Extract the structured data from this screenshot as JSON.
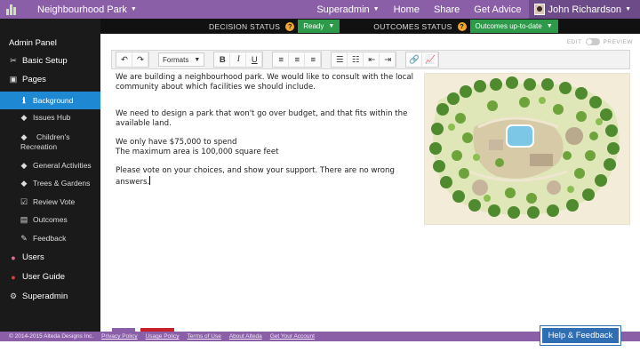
{
  "header": {
    "site_name": "Neighbourhood Park",
    "links": [
      "Superadmin",
      "Home",
      "Share",
      "Get Advice"
    ],
    "user_name": "John Richardson"
  },
  "status": {
    "decision_label": "DECISION STATUS",
    "decision_value": "Ready",
    "outcomes_label": "OUTCOMES STATUS",
    "outcomes_value": "Outcomes up-to-date",
    "question_mark": "?"
  },
  "sidebar": {
    "title": "Admin Panel",
    "items": [
      {
        "label": "Basic Setup",
        "icon": "wrench-icon"
      },
      {
        "label": "Pages",
        "icon": "pages-icon"
      },
      {
        "label": "Background",
        "icon": "info-icon"
      },
      {
        "label": "Issues Hub",
        "icon": "tag-icon"
      },
      {
        "label": "Children's",
        "label2": "Recreation",
        "icon": "tag-icon"
      },
      {
        "label": "General Activities",
        "icon": "tag-icon"
      },
      {
        "label": "Trees & Gardens",
        "icon": "tag-icon"
      },
      {
        "label": "Review Vote",
        "icon": "checkbox-icon"
      },
      {
        "label": "Outcomes",
        "icon": "chart-icon"
      },
      {
        "label": "Feedback",
        "icon": "edit-icon"
      },
      {
        "label": "Users",
        "icon": "users-icon"
      },
      {
        "label": "User Guide",
        "icon": "map-marker-icon"
      },
      {
        "label": "Superadmin",
        "icon": "cogs-icon"
      }
    ]
  },
  "editor": {
    "mode_left": "EDIT",
    "mode_right": "PREVIEW",
    "formats_label": "Formats",
    "paragraphs": [
      "We are building a neighbourhood park. We would like to consult with the local community about which facilities we should include.",
      "We need to design a park that won't go over budget, and that fits within the available land.",
      "We only have $75,000 to spend",
      "The maximum area is 100,000 square feet",
      "Please vote on your choices, and show your support. There are no wrong answers."
    ]
  },
  "footer": {
    "copyright": "© 2014-2015 Alteda Designs Inc.",
    "links": [
      "Privacy Policy",
      "Usage Policy",
      "Terms of Use",
      "About Alteda",
      "Get Your Account"
    ]
  },
  "help_button": "Help & Feedback",
  "colors": {
    "brand_purple": "#8a5fa8",
    "active_blue": "#1e88d2",
    "status_green": "#2d9a4a",
    "help_blue": "#2f6eb3"
  }
}
